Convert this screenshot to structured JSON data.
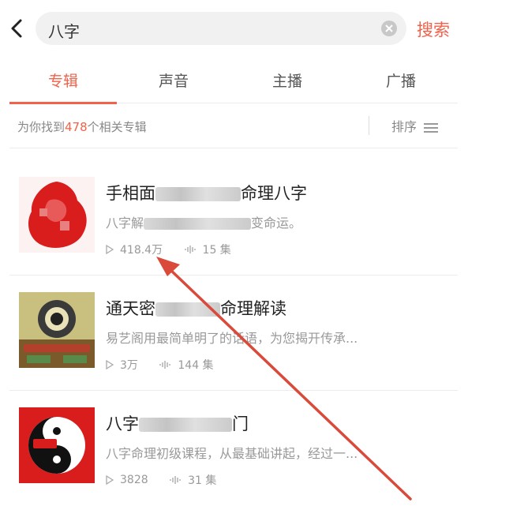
{
  "search": {
    "query": "八字",
    "button_label": "搜索"
  },
  "tabs": [
    {
      "label": "专辑",
      "active": true
    },
    {
      "label": "声音",
      "active": false
    },
    {
      "label": "主播",
      "active": false
    },
    {
      "label": "广播",
      "active": false
    }
  ],
  "results": {
    "prefix": "为你找到",
    "count": "478",
    "suffix": "个相关专辑",
    "sort_label": "排序"
  },
  "albums": [
    {
      "title_start": "手相面",
      "title_end": "命理八字",
      "desc_start": "八字解",
      "desc_end": "变命运。",
      "plays": "418.4万",
      "episodes": "15 集",
      "icon": "red-blob-cover"
    },
    {
      "title_start": "通天密",
      "title_end": "命理解读",
      "desc_start": "易艺阁用最简单明了的话语，为您揭开传承...",
      "desc_end": "",
      "plays": "3万",
      "episodes": "144 集",
      "icon": "bagua-cover"
    },
    {
      "title_start": "八字",
      "title_end": "门",
      "desc_start": "八字命理初级课程，从最基础讲起，经过一...",
      "desc_end": "",
      "plays": "3828",
      "episodes": "31 集",
      "icon": "yin-yang-cover"
    }
  ],
  "colors": {
    "accent": "#f2614a",
    "annotation": "#d94a3a"
  }
}
